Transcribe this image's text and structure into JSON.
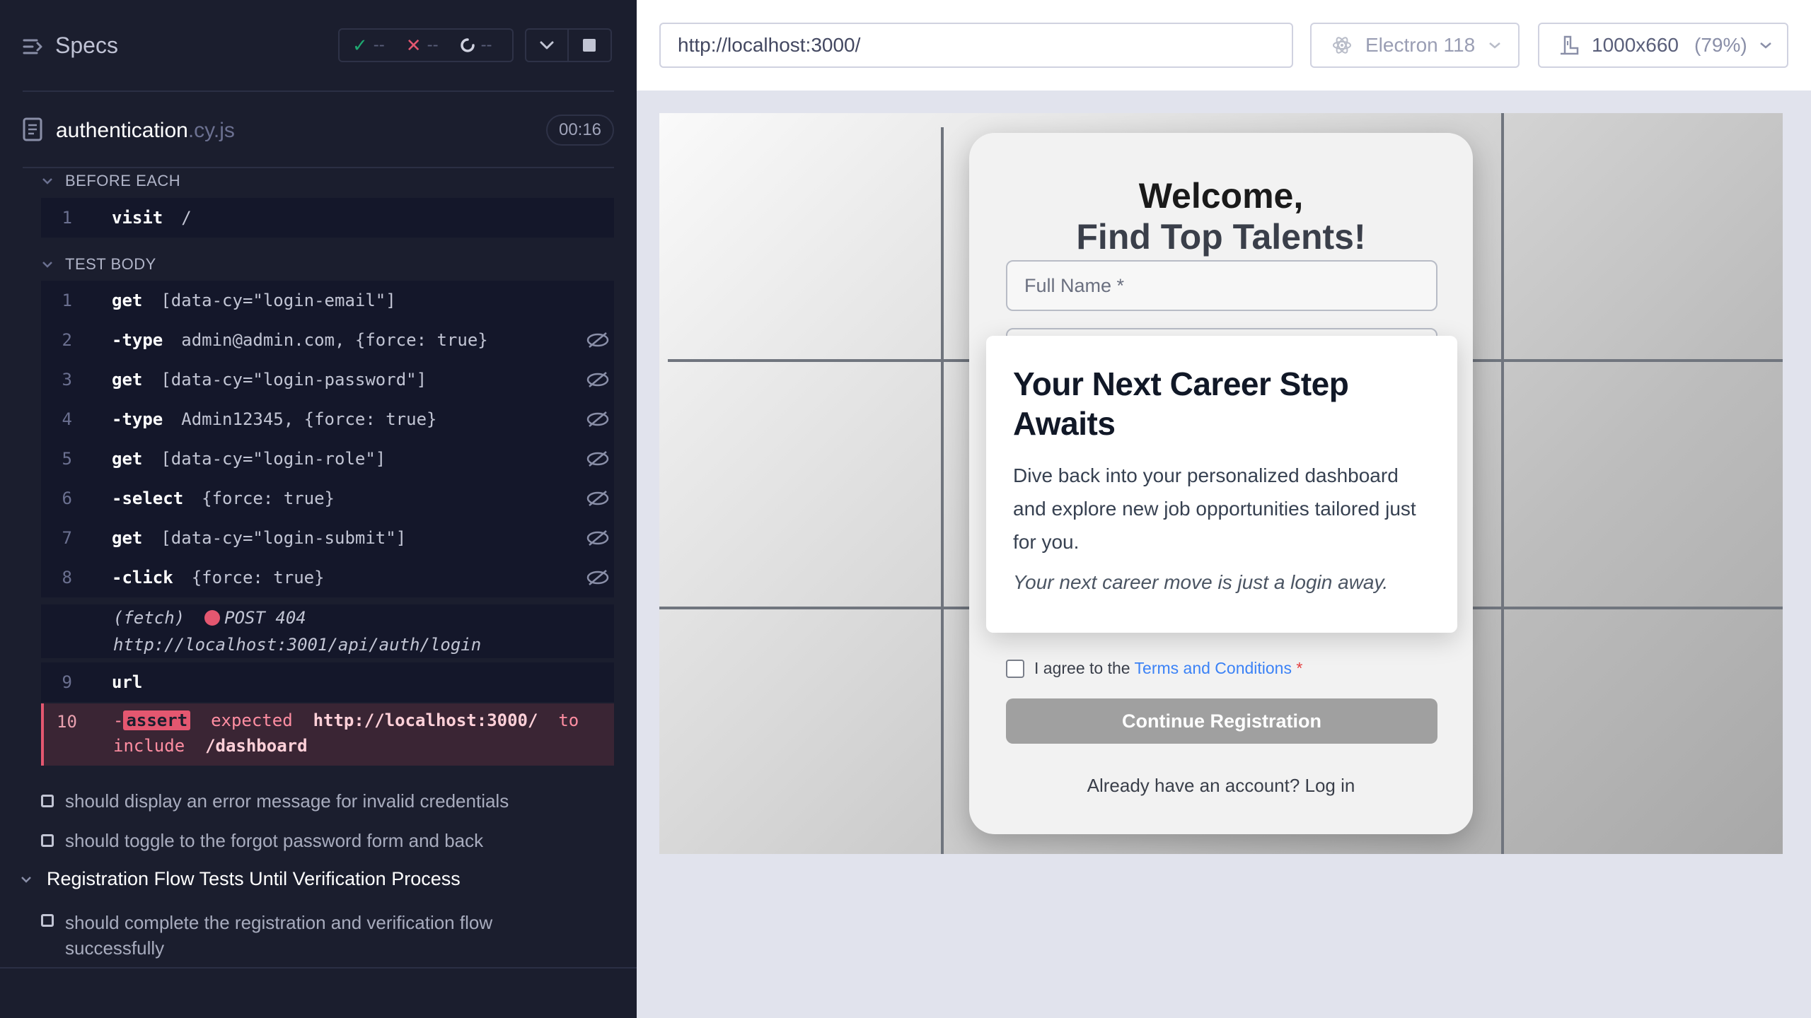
{
  "reporter": {
    "title": "Specs",
    "stats": {
      "passed": "--",
      "failed": "--",
      "pending": "--"
    },
    "file": {
      "name": "authentication",
      "ext": ".cy.js",
      "duration": "00:16"
    },
    "before_each": {
      "label": "BEFORE EACH",
      "commands": [
        {
          "num": "1",
          "name": "visit",
          "arg": "/"
        }
      ]
    },
    "test_body": {
      "label": "TEST BODY",
      "commands": [
        {
          "num": "1",
          "name": "get",
          "arg": "[data-cy=\"login-email\"]"
        },
        {
          "num": "2",
          "name": "-type",
          "arg": "admin@admin.com, {force: true}"
        },
        {
          "num": "3",
          "name": "get",
          "arg": "[data-cy=\"login-password\"]"
        },
        {
          "num": "4",
          "name": "-type",
          "arg": "Admin12345, {force: true}"
        },
        {
          "num": "5",
          "name": "get",
          "arg": "[data-cy=\"login-role\"]"
        },
        {
          "num": "6",
          "name": "-select",
          "arg": "{force: true}"
        },
        {
          "num": "7",
          "name": "get",
          "arg": "[data-cy=\"login-submit\"]"
        },
        {
          "num": "8",
          "name": "-click",
          "arg": "{force: true}"
        }
      ],
      "fetch": {
        "label": "(fetch)",
        "status": "POST 404",
        "url": "http://localhost:3001/api/auth/login"
      },
      "url_cmd": {
        "num": "9",
        "name": "url"
      },
      "assert": {
        "num": "10",
        "dash": "-",
        "badge": "assert",
        "w_expected": "expected",
        "actual": "http://localhost:3000/",
        "w_to": "to",
        "w_include": "include",
        "expected": "/dashboard"
      }
    },
    "tests": [
      "should display an error message for invalid credentials",
      "should toggle to the forgot password form and back"
    ],
    "suite": "Registration Flow Tests Until Verification Process",
    "suite_tests": [
      {
        "line1": "should complete the registration and verification flow",
        "line2": "successfully"
      }
    ]
  },
  "toolbar": {
    "url": "http://localhost:3000/",
    "browser": "Electron 118",
    "viewport": "1000x660",
    "zoom": "(79%)"
  },
  "app": {
    "title_line1": "Welcome,",
    "title_line2": "Find Top Talents!",
    "full_name_placeholder": "Full Name *",
    "agree_prefix": "I agree to the",
    "agree_link": "Terms and Conditions",
    "agree_required": "*",
    "continue_label": "Continue Registration",
    "login_prompt": "Already have an account? Log in",
    "overlay": {
      "title": "Your Next Career Step Awaits",
      "body": "Dive back into your personalized dashboard and explore new job opportunities tailored just for you.",
      "tagline": "Your next career move is just a login away."
    }
  },
  "colors": {
    "reporter_bg": "#1b1e2e",
    "pass": "#1fa971",
    "fail": "#e45770",
    "link": "#3b82f6",
    "button_disabled": "#a0a0a0"
  },
  "icons": [
    "specs-icon",
    "check-icon",
    "x-icon",
    "spinner-icon",
    "chevron-down-icon",
    "stop-icon",
    "file-icon",
    "eye-slash-icon",
    "electron-icon",
    "viewport-icon"
  ]
}
